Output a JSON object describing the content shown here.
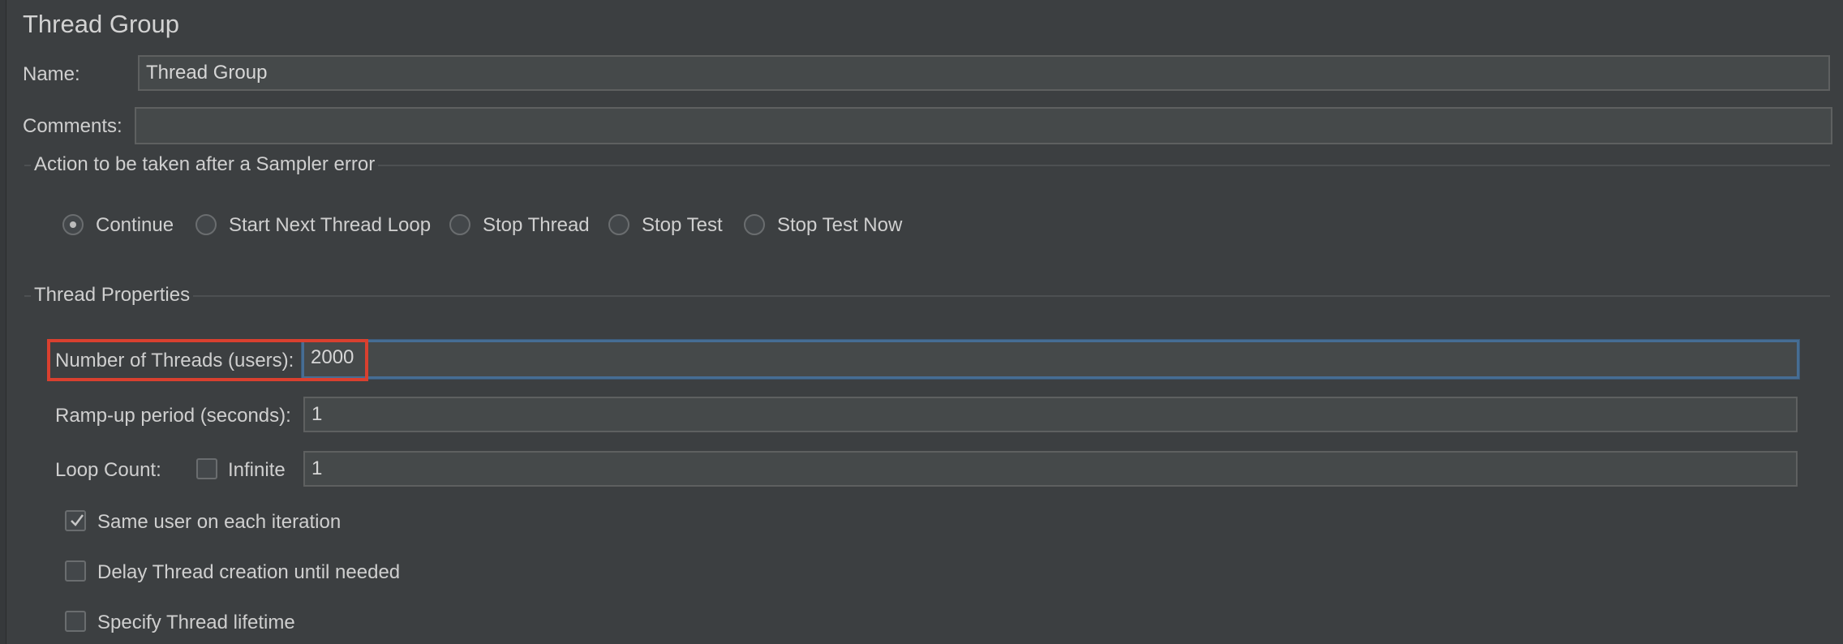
{
  "panel": {
    "title": "Thread Group"
  },
  "name_row": {
    "label": "Name:",
    "value": "Thread Group"
  },
  "comments_row": {
    "label": "Comments:",
    "value": ""
  },
  "sampler_error": {
    "section_title": "Action to be taken after a Sampler error",
    "options": [
      {
        "label": "Continue",
        "selected": true
      },
      {
        "label": "Start Next Thread Loop",
        "selected": false
      },
      {
        "label": "Stop Thread",
        "selected": false
      },
      {
        "label": "Stop Test",
        "selected": false
      },
      {
        "label": "Stop Test Now",
        "selected": false
      }
    ]
  },
  "thread_properties": {
    "section_title": "Thread Properties",
    "num_threads": {
      "label": "Number of Threads (users):",
      "value": "2000"
    },
    "ramp_up": {
      "label": "Ramp-up period (seconds):",
      "value": "1"
    },
    "loop_count": {
      "label": "Loop Count:",
      "infinite_label": "Infinite",
      "infinite_checked": false,
      "value": "1"
    },
    "same_user": {
      "label": "Same user on each iteration",
      "checked": true
    },
    "delay_creation": {
      "label": "Delay Thread creation until needed",
      "checked": false
    },
    "specify_lifetime": {
      "label": "Specify Thread lifetime",
      "checked": false
    }
  },
  "colors": {
    "background": "#3c3f41",
    "field_background": "#45494a",
    "focus_border": "#466d94",
    "annotation_red": "#d9402f"
  }
}
